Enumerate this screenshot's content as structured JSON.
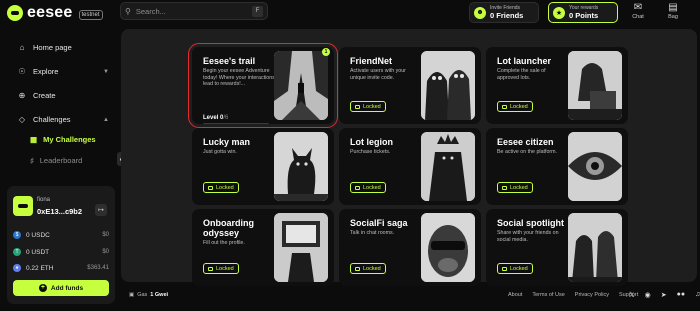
{
  "brand": {
    "name": "eesee",
    "env_badge": "testnet",
    "accent": "#c6ff3d"
  },
  "search": {
    "placeholder": "Search...",
    "shortcut": "F"
  },
  "invite": {
    "label": "Invite Friends",
    "value": "0 Friends"
  },
  "rewards": {
    "label": "Your rewards",
    "value": "0 Points"
  },
  "topbar": {
    "chat_label": "Chat",
    "bag_label": "Bag"
  },
  "sidebar": {
    "items": [
      {
        "label": "Home page",
        "icon": "home-icon"
      },
      {
        "label": "Explore",
        "icon": "compass-icon"
      },
      {
        "label": "Create",
        "icon": "plus-circle-icon"
      },
      {
        "label": "Challenges",
        "icon": "diamond-icon"
      }
    ],
    "sub_items": [
      {
        "label": "My Challenges",
        "icon": "grid-icon",
        "active": true
      },
      {
        "label": "Leaderboard",
        "icon": "trophy-icon",
        "active": false
      }
    ]
  },
  "wallet": {
    "name": "fiona",
    "address": "0xE13...c9b2",
    "balances": [
      {
        "amount": "0 USDC",
        "usd": "$0",
        "icon": "usdc-icon",
        "color": "#2775ca"
      },
      {
        "amount": "0 USDT",
        "usd": "$0",
        "icon": "usdt-icon",
        "color": "#26a17b"
      },
      {
        "amount": "0.22 ETH",
        "usd": "$363.41",
        "icon": "eth-icon",
        "color": "#627eea"
      }
    ],
    "add_funds_label": "Add funds"
  },
  "challenges": [
    {
      "title": "Eesee's trail",
      "desc": "Begin your eesee Adventure today! Where your interactions lead to rewards!...",
      "level": "Level 0",
      "level_total": "/6",
      "progress": 0,
      "badge": "1",
      "selected": true,
      "image": "forest-shrine-image"
    },
    {
      "title": "FriendNet",
      "desc": "Activate users with your unique invite code.",
      "status": "Locked",
      "image": "hooded-figures-image"
    },
    {
      "title": "Lot launcher",
      "desc": "Complete the sale of approved lots.",
      "status": "Locked",
      "image": "hooded-hacker-image"
    },
    {
      "title": "Lucky man",
      "desc": "Just gotta win.",
      "status": "Locked",
      "image": "black-cat-image"
    },
    {
      "title": "Lot legion",
      "desc": "Purchase tickets.",
      "status": "Locked",
      "image": "dark-king-image"
    },
    {
      "title": "Eesee citizen",
      "desc": "Be active on the platform.",
      "status": "Locked",
      "image": "eye-portal-image"
    },
    {
      "title": "Onboarding odyssey",
      "desc": "Fill out the profile.",
      "status": "Locked",
      "image": "robot-monitor-image"
    },
    {
      "title": "SocialFi saga",
      "desc": "Talk in chat rooms.",
      "status": "Locked",
      "image": "ape-sunglasses-image"
    },
    {
      "title": "Social spotlight",
      "desc": "Share with your friends on social media.",
      "status": "Locked",
      "image": "hooded-friends-image"
    }
  ],
  "footer": {
    "gas_label": "Gas",
    "gas_value": "1 Gwei",
    "links": [
      "About",
      "Terms of Use",
      "Privacy Policy",
      "Support"
    ],
    "socials": [
      "twitter-icon",
      "discord-icon",
      "telegram-icon",
      "medium-icon",
      "tiktok-icon"
    ]
  }
}
